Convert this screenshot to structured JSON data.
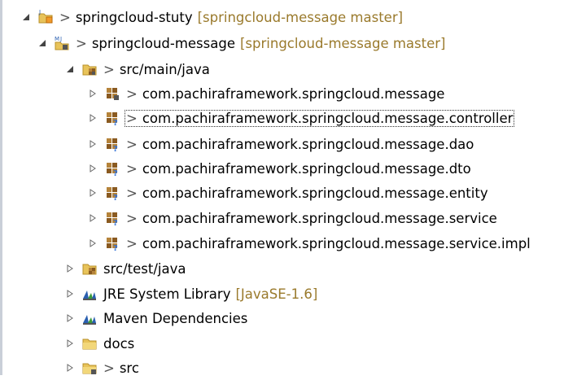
{
  "tree": {
    "root": {
      "prefix": ">",
      "label": "springcloud-stuty",
      "decoration": "[springcloud-message master]",
      "icon": "project-folder-git-icon"
    },
    "module": {
      "prefix": ">",
      "label": "springcloud-message",
      "decoration": "[springcloud-message master]",
      "icon": "maven-project-icon"
    },
    "src_main": {
      "prefix": ">",
      "label": "src/main/java",
      "icon": "source-folder-icon"
    },
    "packages": [
      {
        "prefix": ">",
        "label": "com.pachiraframework.springcloud.message",
        "icon": "package-icon"
      },
      {
        "prefix": ">",
        "label": "com.pachiraframework.springcloud.message.controller",
        "icon": "package-unversioned-icon"
      },
      {
        "prefix": ">",
        "label": "com.pachiraframework.springcloud.message.dao",
        "icon": "package-unversioned-icon"
      },
      {
        "prefix": ">",
        "label": "com.pachiraframework.springcloud.message.dto",
        "icon": "package-unversioned-icon"
      },
      {
        "prefix": ">",
        "label": "com.pachiraframework.springcloud.message.entity",
        "icon": "package-unversioned-icon"
      },
      {
        "prefix": ">",
        "label": "com.pachiraframework.springcloud.message.service",
        "icon": "package-unversioned-icon"
      },
      {
        "prefix": ">",
        "label": "com.pachiraframework.springcloud.message.service.impl",
        "icon": "package-unversioned-icon"
      }
    ],
    "src_test": {
      "label": "src/test/java",
      "icon": "source-folder-icon"
    },
    "jre": {
      "label": "JRE System Library",
      "decoration": "[JavaSE-1.6]",
      "icon": "library-icon"
    },
    "maven": {
      "label": "Maven Dependencies",
      "icon": "library-icon"
    },
    "docs": {
      "label": "docs",
      "icon": "folder-icon"
    },
    "src": {
      "prefix": ">",
      "label": "src",
      "icon": "folder-icon"
    }
  },
  "colors": {
    "decoration": "#9a7a2c",
    "folder": "#e8c35a",
    "package": "#b5833a",
    "unversioned": "#2f6fd6",
    "library_blue": "#2a5fb0",
    "library_green": "#3a9a3a"
  }
}
